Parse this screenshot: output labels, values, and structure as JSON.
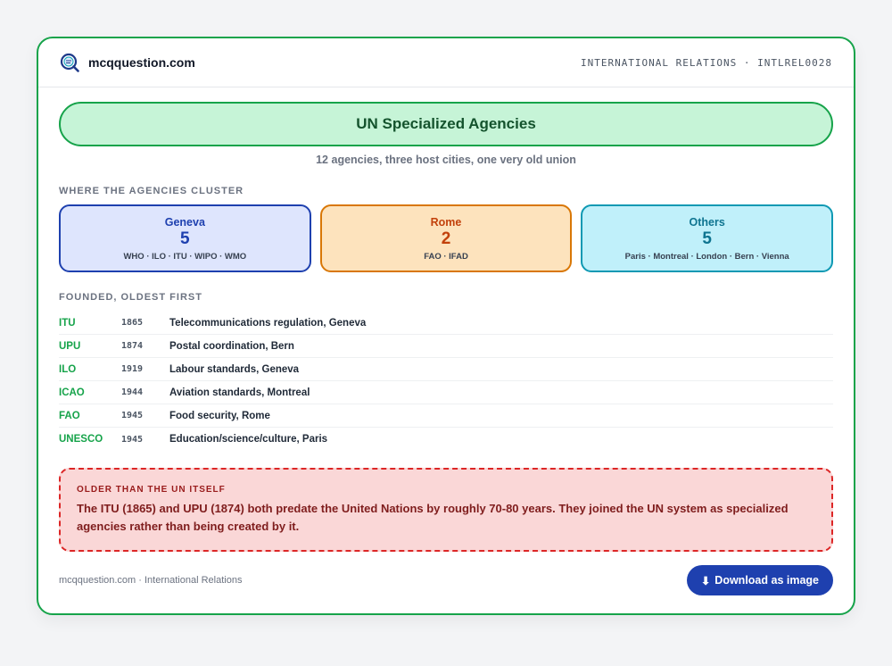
{
  "brand": {
    "name": "mcqquestion.com",
    "logo_icon": "magnifier-logo-icon"
  },
  "header": {
    "tag": "INTERNATIONAL RELATIONS · INTLREL0028"
  },
  "title": "UN Specialized Agencies",
  "subtitle": "12 agencies, three host cities, one very old union",
  "clusters_section": {
    "label": "WHERE THE AGENCIES CLUSTER",
    "items": [
      {
        "name": "Geneva",
        "count": "5",
        "list": "WHO · ILO · ITU · WIPO · WMO",
        "color": "#1e40af",
        "bg": "#dee5fd"
      },
      {
        "name": "Rome",
        "count": "2",
        "list": "FAO · IFAD",
        "color": "#d97706",
        "bg": "#fde3bd"
      },
      {
        "name": "Others",
        "count": "5",
        "list": "Paris · Montreal · London · Bern · Vienna",
        "color": "#0e99b3",
        "bg": "#c0f0fa"
      }
    ]
  },
  "founded_section": {
    "label": "FOUNDED, OLDEST FIRST",
    "rows": [
      {
        "code": "ITU",
        "year": "1865",
        "desc": "Telecommunications regulation, Geneva"
      },
      {
        "code": "UPU",
        "year": "1874",
        "desc": "Postal coordination, Bern"
      },
      {
        "code": "ILO",
        "year": "1919",
        "desc": "Labour standards, Geneva"
      },
      {
        "code": "ICAO",
        "year": "1944",
        "desc": "Aviation standards, Montreal"
      },
      {
        "code": "FAO",
        "year": "1945",
        "desc": "Food security, Rome"
      },
      {
        "code": "UNESCO",
        "year": "1945",
        "desc": "Education/science/culture, Paris"
      }
    ]
  },
  "note": {
    "label": "OLDER THAN THE UN ITSELF",
    "text": "The ITU (1865) and UPU (1874) both predate the United Nations by roughly 70-80 years. They joined the UN system as specialized agencies rather than being created by it."
  },
  "footer": {
    "text": "mcqquestion.com · International Relations",
    "download_label": "Download as image",
    "download_icon": "⬇"
  },
  "colors": {
    "accent": "#16a34a",
    "button": "#1e40af",
    "note_border": "#dc2626"
  }
}
